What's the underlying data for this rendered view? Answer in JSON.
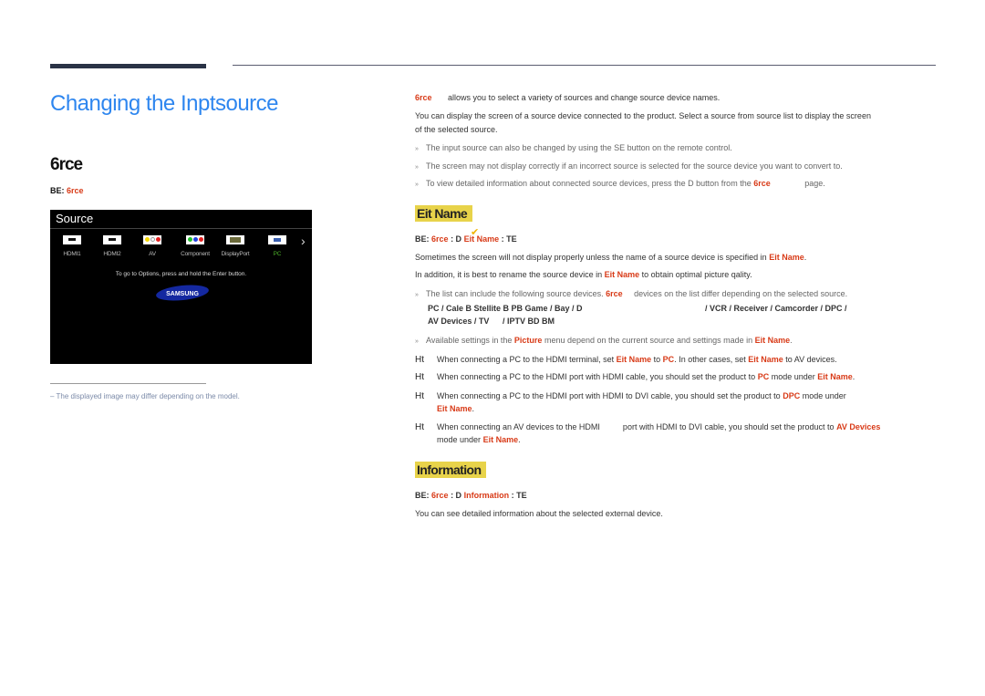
{
  "page_title": "Changing the Inptsource",
  "left": {
    "section_title": "6rce",
    "menu_path": {
      "prefix": "BE:",
      "item": "6rce"
    },
    "source_panel": {
      "header": "Source",
      "sources": [
        {
          "label": "HDMI1",
          "icon": "hdmi-port-icon"
        },
        {
          "label": "HDMI2",
          "icon": "hdmi-port-icon"
        },
        {
          "label": "AV",
          "icon": "av-port-icon"
        },
        {
          "label": "Component",
          "icon": "component-port-icon"
        },
        {
          "label": "DisplayPort",
          "icon": "displayport-icon"
        },
        {
          "label": "PC",
          "icon": "vga-port-icon",
          "selected": true
        }
      ],
      "selected_color": "#4caf2a",
      "check_color": "#f0b400",
      "hint": "To go to Options, press and hold the Enter button.",
      "logo_text": "SAMSUNG"
    },
    "footnote": "The displayed image may differ depending on the model."
  },
  "right": {
    "intro": {
      "term": "6rce",
      "text": "allows you to select a variety of sources and change source device names."
    },
    "intro2_line1": "You can display the screen of a source device connected to the product. Select a source from source list to display the screen",
    "intro2_line2": "of the selected source.",
    "notes": [
      "The input source can also be changed by using the SE button on the remote control.",
      "The screen may not display correctly if an incorrect source is selected for the source device you want to convert to."
    ],
    "note3": {
      "pre": "To view detailed information about connected source devices, press the D button from the",
      "term": "6rce",
      "post": "page."
    },
    "edit_name": {
      "heading": "Eit Name",
      "path": {
        "prefix": "BE:",
        "a": "6rce",
        "mid": ": D",
        "b": "Eit Name",
        "suffix": ": TE"
      },
      "p1": {
        "text": "Sometimes the screen will not display properly unless the name of a source device is specified in",
        "term": "Eit Name",
        "end": "."
      },
      "p2": {
        "pre": "In addition, it is best to rename the source device in",
        "term": "Eit Name",
        "post": "to obtain optimal picture qality."
      },
      "list_note": {
        "pre": "The list can include the following source devices.",
        "term": "6rce",
        "post": "devices on the list differ depending on the selected source."
      },
      "device_line1a": "PC / Cale B Stellite B PB Game / Bay / D",
      "device_line1b": "/ VCR / Receiver / Camcorder / DPC /",
      "device_line2a": "AV Devices / TV",
      "device_line2b": "/ IPTV BD BM",
      "avail": {
        "pre": "Available settings in the",
        "term": "Picture",
        "mid": "menu depend on the current source and settings made in",
        "term2": "Eit Name",
        "end": "."
      },
      "ht_items": [
        {
          "pre": "When connecting a PC to the HDMI terminal, set",
          "t1": "Eit Name",
          "m1": "to",
          "t2": "PC",
          "m2": ". In other cases, set",
          "t3": "Eit Name",
          "end": "to AV devices."
        },
        {
          "pre": "When connecting a PC to the HDMI port with HDMI cable, you should set the product to",
          "t1": "PC",
          "m1": "mode under",
          "t2": "Eit Name",
          "end": "."
        },
        {
          "pre": "When connecting a PC to the HDMI port with HDMI to DVI cable, you should set the product to",
          "t1": "DPC",
          "m1": "mode under",
          "t2": "Eit Name",
          "end": "."
        },
        {
          "pre": "When connecting an AV devices to the HDMI          port with HDMI to DVI cable, you should set the product to",
          "t1": "AV Devices",
          "m1": "mode under",
          "t2": "Eit Name",
          "end": "."
        }
      ],
      "ht_label": "Ht"
    },
    "information": {
      "heading": "Information",
      "path": {
        "prefix": "BE:",
        "a": "6rce",
        "mid": ": D",
        "b": "Information",
        "suffix": ": TE"
      },
      "text": "You can see detailed information about the selected external device."
    }
  },
  "colors": {
    "title_blue": "#2e86ef",
    "term_red": "#d83a17",
    "highlight_yellow": "#e8d34a"
  }
}
